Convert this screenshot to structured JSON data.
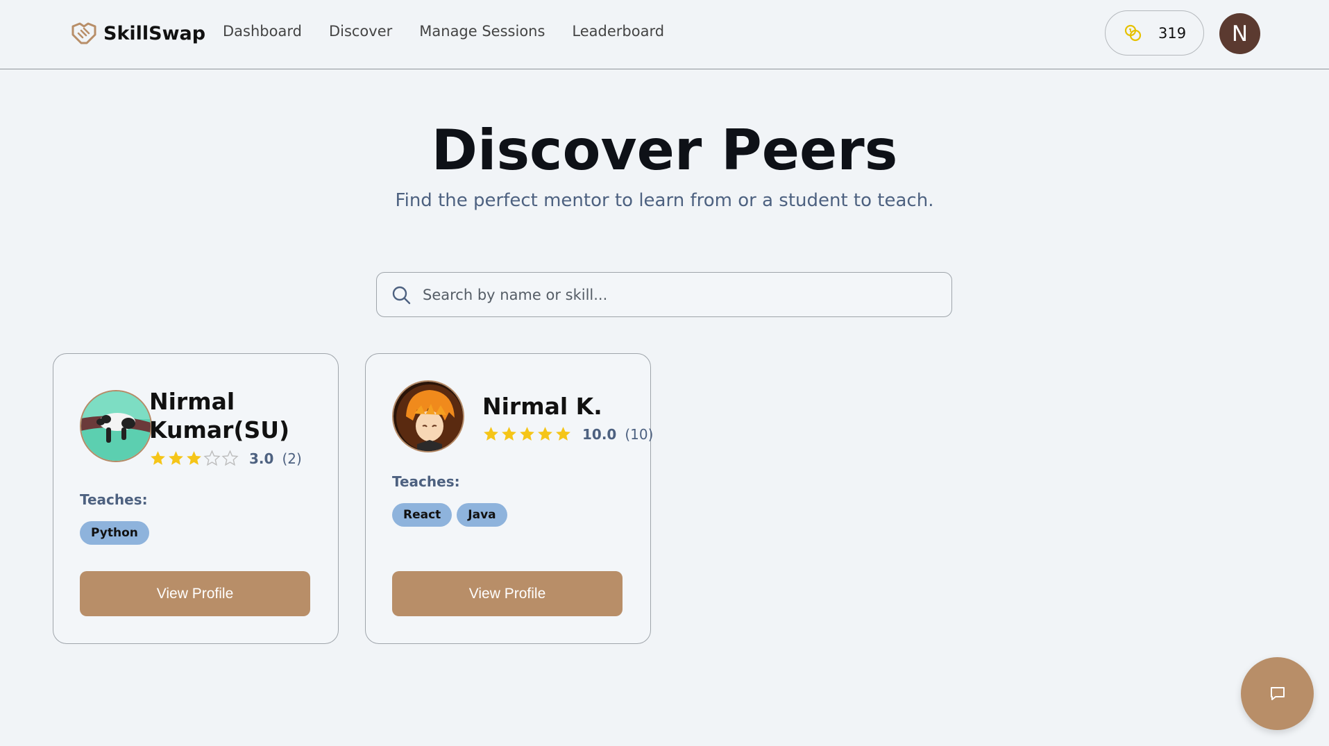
{
  "app": {
    "name": "SkillSwap",
    "brand_color": "#b88e68"
  },
  "nav": {
    "items": [
      {
        "label": "Dashboard"
      },
      {
        "label": "Discover"
      },
      {
        "label": "Manage Sessions"
      },
      {
        "label": "Leaderboard"
      }
    ]
  },
  "header": {
    "coins": "319",
    "coins_icon": "coins-icon",
    "user_initial": "N"
  },
  "main": {
    "title": "Discover Peers",
    "subtitle": "Find the perfect mentor to learn from or a student to teach."
  },
  "search": {
    "placeholder": "Search by name or skill...",
    "value": ""
  },
  "peers": [
    {
      "name": "Nirmal Kumar(SU)",
      "rating": "3.0",
      "rating_stars": 3,
      "reviews": "(2)",
      "teaches_label": "Teaches:",
      "skills": [
        "Python"
      ],
      "button": "View Profile"
    },
    {
      "name": "Nirmal K.",
      "rating": "10.0",
      "rating_stars": 5,
      "reviews": "(10)",
      "teaches_label": "Teaches:",
      "skills": [
        "React",
        "Java"
      ],
      "button": "View Profile"
    }
  ],
  "chat": {
    "icon": "chat-icon"
  }
}
